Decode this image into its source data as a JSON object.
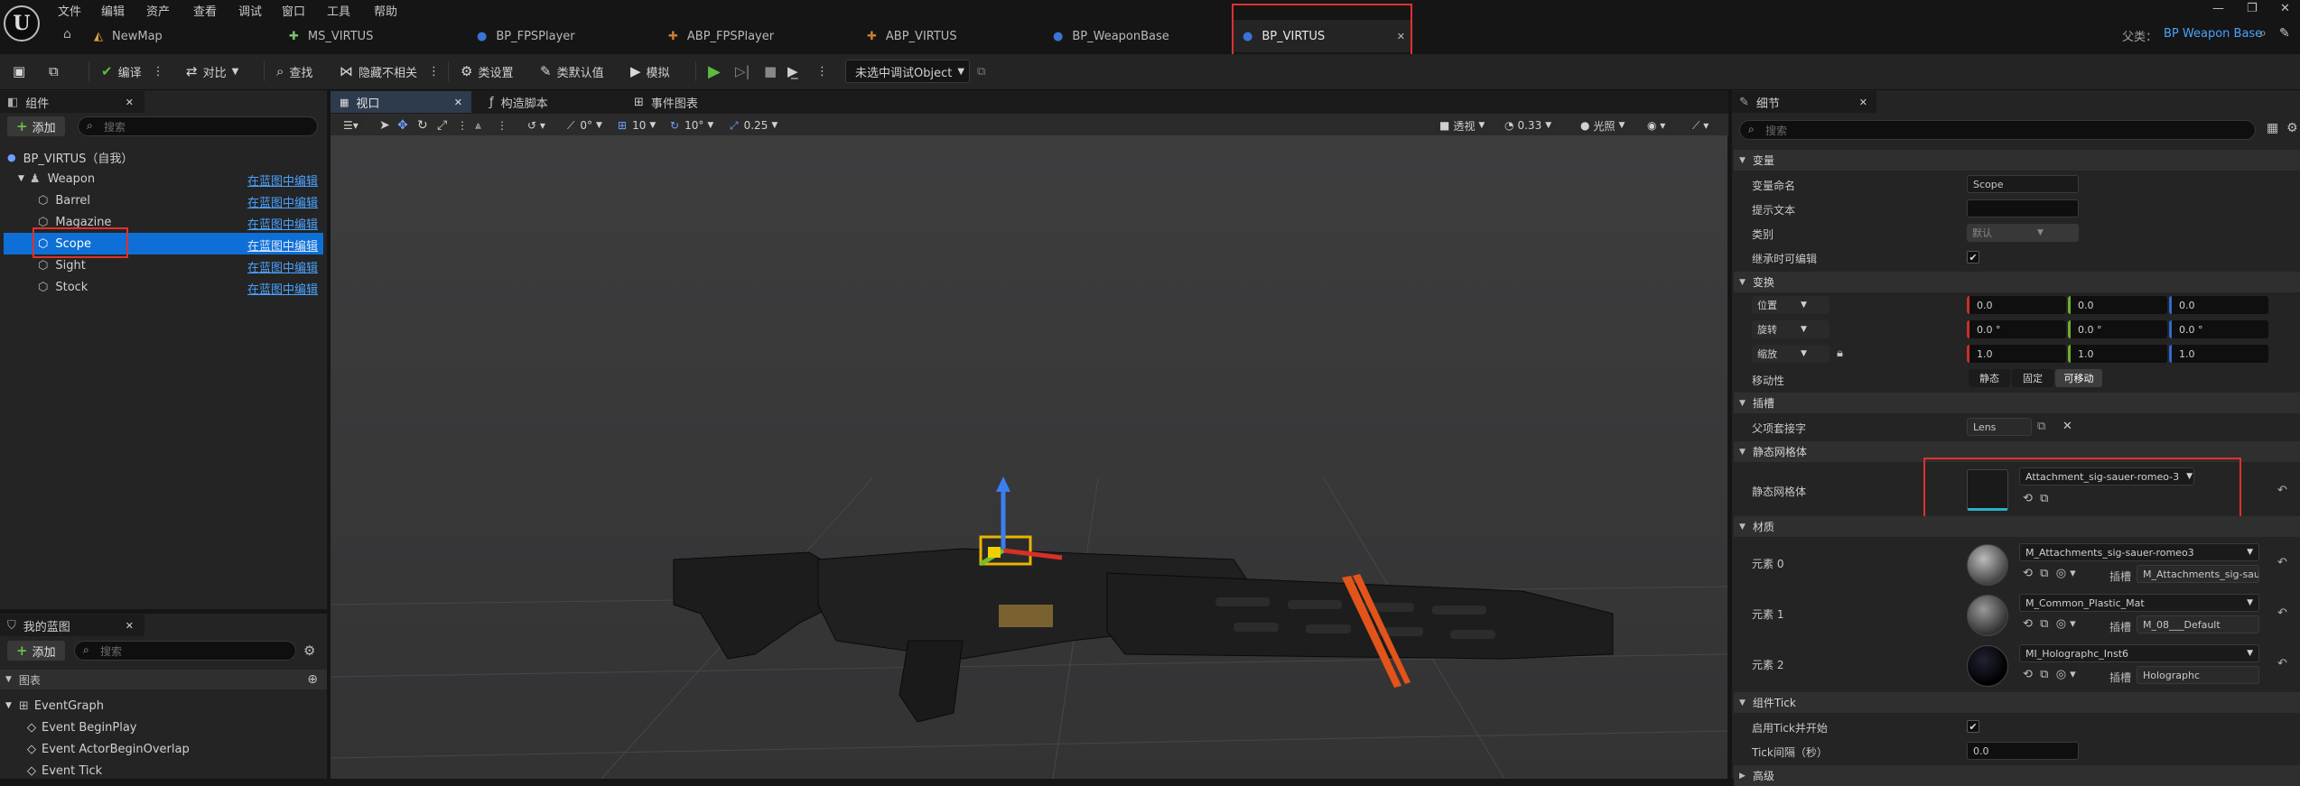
{
  "menu": [
    "文件",
    "编辑",
    "资产",
    "查看",
    "调试",
    "窗口",
    "工具",
    "帮助"
  ],
  "doc_tabs": [
    {
      "label": "NewMap",
      "icon": "map-icon"
    },
    {
      "label": "MS_VIRTUS",
      "icon": "skeleton-icon"
    },
    {
      "label": "BP_FPSPlayer",
      "icon": "blueprint-icon"
    },
    {
      "label": "ABP_FPSPlayer",
      "icon": "anim-blueprint-icon"
    },
    {
      "label": "ABP_VIRTUS",
      "icon": "anim-blueprint-icon"
    },
    {
      "label": "BP_WeaponBase",
      "icon": "blueprint-icon"
    },
    {
      "label": "BP_VIRTUS",
      "icon": "blueprint-icon"
    }
  ],
  "parent_class": {
    "label": "父类：",
    "value": "BP Weapon Base"
  },
  "toolbar": {
    "compile": "编译",
    "diff": "对比",
    "find": "查找",
    "hide_unrelated": "隐藏不相关",
    "class_settings": "类设置",
    "class_defaults": "类默认值",
    "simulate": "模拟",
    "debug_object": "未选中调试Object"
  },
  "components_panel": {
    "title": "组件",
    "add": "添加",
    "search_placeholder": "搜索",
    "root": "BP_VIRTUS（自我）",
    "items": [
      {
        "label": "Weapon",
        "link": "在蓝图中编辑"
      },
      {
        "label": "Barrel",
        "link": "在蓝图中编辑"
      },
      {
        "label": "Magazine",
        "link": "在蓝图中编辑"
      },
      {
        "label": "Scope",
        "link": "在蓝图中编辑"
      },
      {
        "label": "Sight",
        "link": "在蓝图中编辑"
      },
      {
        "label": "Stock",
        "link": "在蓝图中编辑"
      }
    ]
  },
  "my_blueprint": {
    "title": "我的蓝图",
    "add": "添加",
    "search_placeholder": "搜索",
    "graphs": "图表",
    "event_graph": "EventGraph",
    "events": [
      "Event BeginPlay",
      "Event ActorBeginOverlap",
      "Event Tick"
    ]
  },
  "editor_tabs": [
    "视口",
    "构造脚本",
    "事件图表"
  ],
  "viewport_toolbar": {
    "rotate_snap": "0°",
    "grid_snap": "10",
    "angle_snap": "10°",
    "scale_snap": "0.25",
    "perspective": "透视",
    "camera_speed": "0.33",
    "lit": "光照"
  },
  "details": {
    "title": "细节",
    "search_placeholder": "搜索",
    "sections": {
      "variable": "变量",
      "transform": "变换",
      "sockets": "插槽",
      "static_mesh": "静态网格体",
      "materials": "材质",
      "component_tick": "组件Tick",
      "advanced": "高级"
    },
    "variable_name": {
      "label": "变量命名",
      "value": "Scope"
    },
    "tooltip": {
      "label": "提示文本",
      "value": ""
    },
    "category": {
      "label": "类别",
      "value": "默认"
    },
    "editable_when_inherited": {
      "label": "继承时可编辑",
      "checked": true
    },
    "location": {
      "label": "位置",
      "x": "0.0",
      "y": "0.0",
      "z": "0.0"
    },
    "rotation": {
      "label": "旋转",
      "x": "0.0 °",
      "y": "0.0 °",
      "z": "0.0 °"
    },
    "scale": {
      "label": "缩放",
      "x": "1.0",
      "y": "1.0",
      "z": "1.0"
    },
    "mobility": {
      "label": "移动性",
      "options": [
        "静态",
        "固定",
        "可移动"
      ],
      "selected": "可移动"
    },
    "parent_socket": {
      "label": "父项套接字",
      "value": "Lens"
    },
    "static_mesh": {
      "label": "静态网格体",
      "value": "Attachment_sig-sauer-romeo-3"
    },
    "slot_label": "插槽",
    "elements": [
      {
        "label": "元素 0",
        "material": "M_Attachments_sig-sauer-romeo3",
        "slot": "M_Attachments_sig-saue"
      },
      {
        "label": "元素 1",
        "material": "M_Common_Plastic_Mat",
        "slot": "M_08___Default"
      },
      {
        "label": "元素 2",
        "material": "MI_Holographc_Inst6",
        "slot": "Holographc"
      }
    ],
    "start_with_tick": {
      "label": "启用Tick并开始",
      "checked": true
    },
    "tick_interval": {
      "label": "Tick间隔（秒）",
      "value": "0.0"
    }
  },
  "colors": {
    "accent_blue": "#0e6fd6",
    "highlight_red": "#e0302c",
    "link_blue": "#4aa2ff",
    "play_green": "#5dbb3d"
  }
}
